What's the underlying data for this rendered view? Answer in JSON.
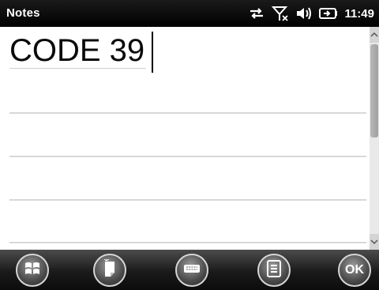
{
  "status_bar": {
    "title": "Notes",
    "clock": "11:49",
    "icons": [
      "connectivity-arrows-icon",
      "no-signal-antenna-icon",
      "speaker-muted-icon",
      "battery-charging-icon"
    ]
  },
  "note": {
    "text": "CODE 39"
  },
  "softkeys": {
    "ok_label": "OK",
    "icons": [
      "windows-start-icon",
      "new-note-icon",
      "keyboard-icon",
      "menu-icon",
      "ok-icon"
    ]
  }
}
